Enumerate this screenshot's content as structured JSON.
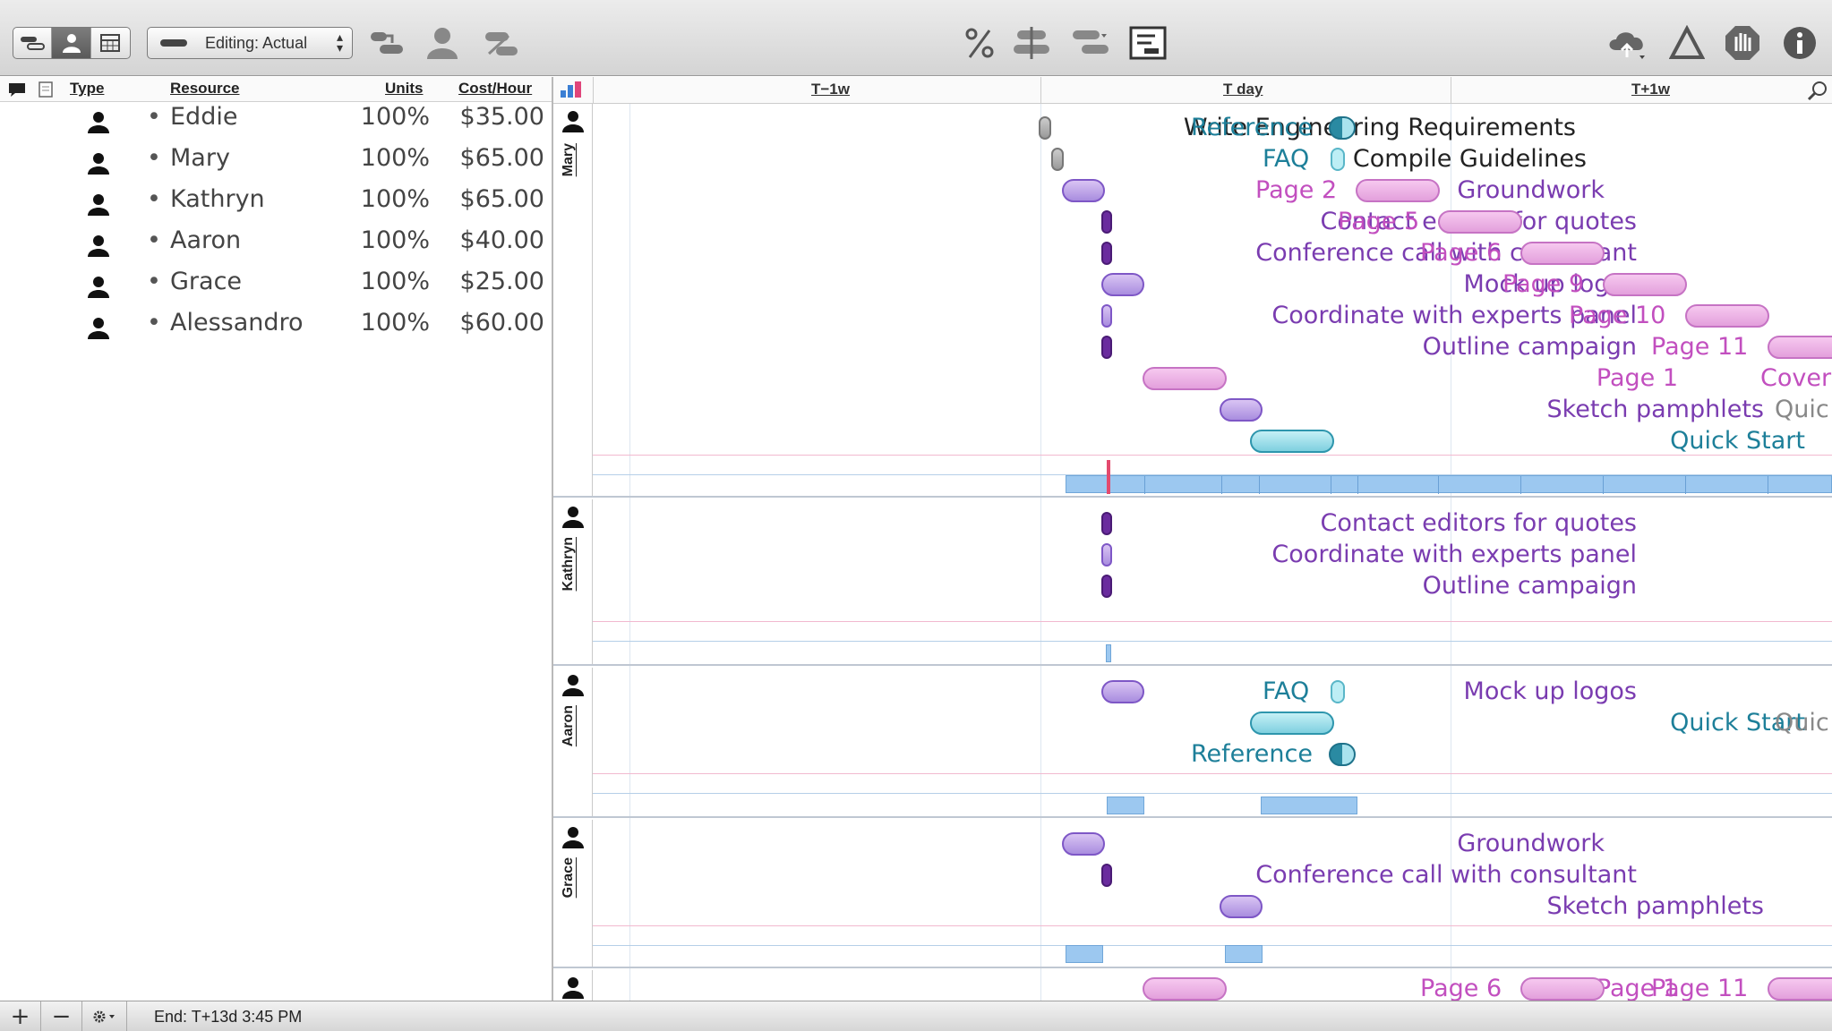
{
  "toolbar": {
    "editing_popup": "Editing: Actual"
  },
  "resources": {
    "headers": {
      "type": "Type",
      "resource": "Resource",
      "units": "Units",
      "cost": "Cost/Hour"
    },
    "rows": [
      {
        "name": "Eddie",
        "units": "100%",
        "cost": "$35.00"
      },
      {
        "name": "Mary",
        "units": "100%",
        "cost": "$65.00"
      },
      {
        "name": "Kathryn",
        "units": "100%",
        "cost": "$65.00"
      },
      {
        "name": "Aaron",
        "units": "100%",
        "cost": "$40.00"
      },
      {
        "name": "Grace",
        "units": "100%",
        "cost": "$25.00"
      },
      {
        "name": "Alessandro",
        "units": "100%",
        "cost": "$60.00"
      }
    ]
  },
  "timeline": {
    "t_minus_1w": "T−1w",
    "t_day": "T day",
    "t_plus_1w": "T+1w"
  },
  "sections": {
    "mary": {
      "name": "Mary",
      "tasks": {
        "t1": "Write Engineering Requirements",
        "t2": "Compile Guidelines",
        "t3": "Groundwork",
        "t4": "Contact editors for quotes",
        "t5": "Conference call with consultant",
        "t6": "Mock up logos",
        "t7": "Coordinate with experts panel",
        "t8": "Outline campaign",
        "t9": "Page 1",
        "t10": "Sketch pamphlets",
        "t11": "Quick Start",
        "r1": "Reference",
        "r2": "FAQ",
        "r3": "Page 2",
        "r4": "Page 5",
        "r5": "Page 6",
        "r6": "Page 9",
        "r7": "Page 10",
        "r8": "Page 11",
        "r9": "Cover",
        "r10": "Quic"
      }
    },
    "kathryn": {
      "name": "Kathryn",
      "tasks": {
        "t1": "Contact editors for quotes",
        "t2": "Coordinate with experts panel",
        "t3": "Outline campaign"
      }
    },
    "aaron": {
      "name": "Aaron",
      "tasks": {
        "t1": "Mock up logos",
        "t2": "FAQ",
        "t3": "Quick Start",
        "t4": "Reference",
        "t5": "Quic"
      }
    },
    "grace": {
      "name": "Grace",
      "tasks": {
        "t1": "Groundwork",
        "t2": "Conference call with consultant",
        "t3": "Sketch pamphlets"
      }
    },
    "last": {
      "tasks": {
        "t1": "Page 1",
        "t2": "Page 6",
        "t3": "Page 11"
      }
    }
  },
  "status": {
    "add": "+",
    "remove": "−",
    "end_text": "End: T+13d 3:45 PM"
  },
  "colors": {
    "purple_text": "#7a3cb0",
    "pink_text": "#c24fbf",
    "teal_text": "#1d7f99",
    "black_text": "#222222"
  }
}
